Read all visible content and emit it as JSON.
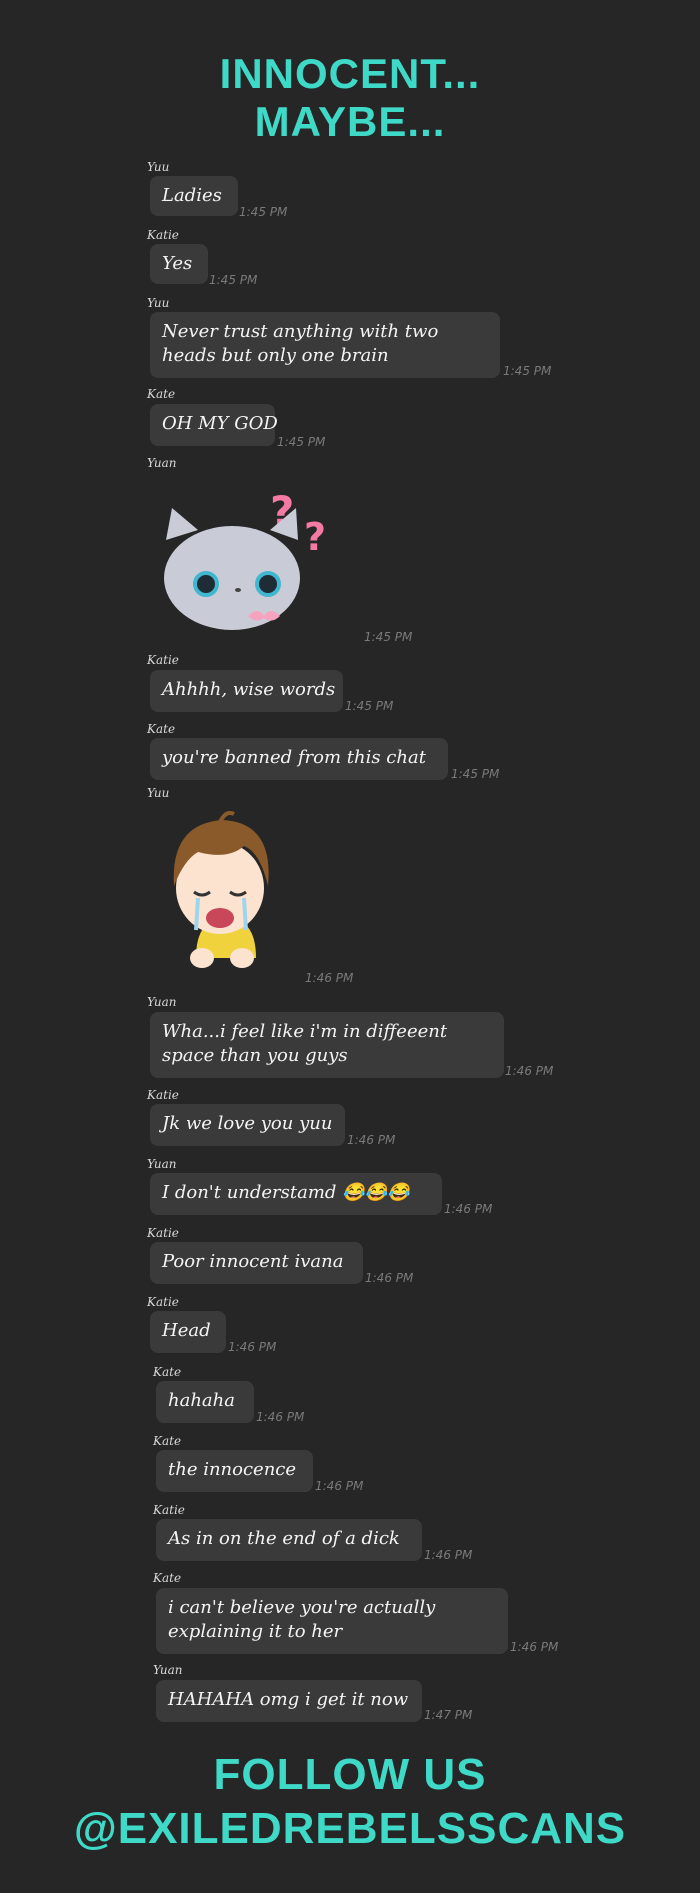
{
  "header": {
    "line1": "INNOCENT...",
    "line2": "MAYBE..."
  },
  "messages": [
    {
      "sender": "Yuu",
      "text": "Ladies",
      "time": "1:45 PM"
    },
    {
      "sender": "Katie",
      "text": "Yes",
      "time": "1:45 PM"
    },
    {
      "sender": "Yuu",
      "text": "Never trust anything with two",
      "text2": "heads but only one brain",
      "time": "1:45 PM"
    },
    {
      "sender": "Kate",
      "text": "OH MY GOD",
      "time": "1:45 PM"
    },
    {
      "sender": "Yuan",
      "sticker": "confused-cat-sticker",
      "time": "1:45 PM"
    },
    {
      "sender": "Katie",
      "text": "Ahhhh, wise words",
      "time": "1:45 PM"
    },
    {
      "sender": "Kate",
      "text": "you're banned from this chat",
      "time": "1:45 PM"
    },
    {
      "sender": "Yuu",
      "sticker": "crying-boy-sticker",
      "time": "1:46 PM"
    },
    {
      "sender": "Yuan",
      "text": "Wha...i feel like i'm in diffeeent",
      "text2": "space than you guys",
      "time": "1:46 PM"
    },
    {
      "sender": "Katie",
      "text": "Jk we love you yuu",
      "time": "1:46 PM"
    },
    {
      "sender": "Yuan",
      "text": "I don't understamd 😂😂😂",
      "time": "1:46 PM"
    },
    {
      "sender": "Katie",
      "text": "Poor innocent ivana",
      "time": "1:46 PM"
    },
    {
      "sender": "Katie",
      "text": "Head",
      "time": "1:46 PM"
    },
    {
      "sender": "Kate",
      "text": "hahaha",
      "time": "1:46 PM"
    },
    {
      "sender": "Kate",
      "text": "the innocence",
      "time": "1:46 PM"
    },
    {
      "sender": "Katie",
      "text": "As in on the end of a dick",
      "time": "1:46 PM"
    },
    {
      "sender": "Kate",
      "text": "i can't believe you're actually",
      "text2": "explaining it to her",
      "time": "1:46 PM"
    },
    {
      "sender": "Yuan",
      "text": "HAHAHA omg i get it now",
      "time": "1:47 PM"
    }
  ],
  "footer": {
    "line1": "FOLLOW US",
    "line2": "@EXILEDREBELSSCANS"
  },
  "colors": {
    "accent": "#3fd9c8",
    "background": "#262626",
    "bubble": "#3a3a3a",
    "timestamp": "#7a7a7a"
  }
}
